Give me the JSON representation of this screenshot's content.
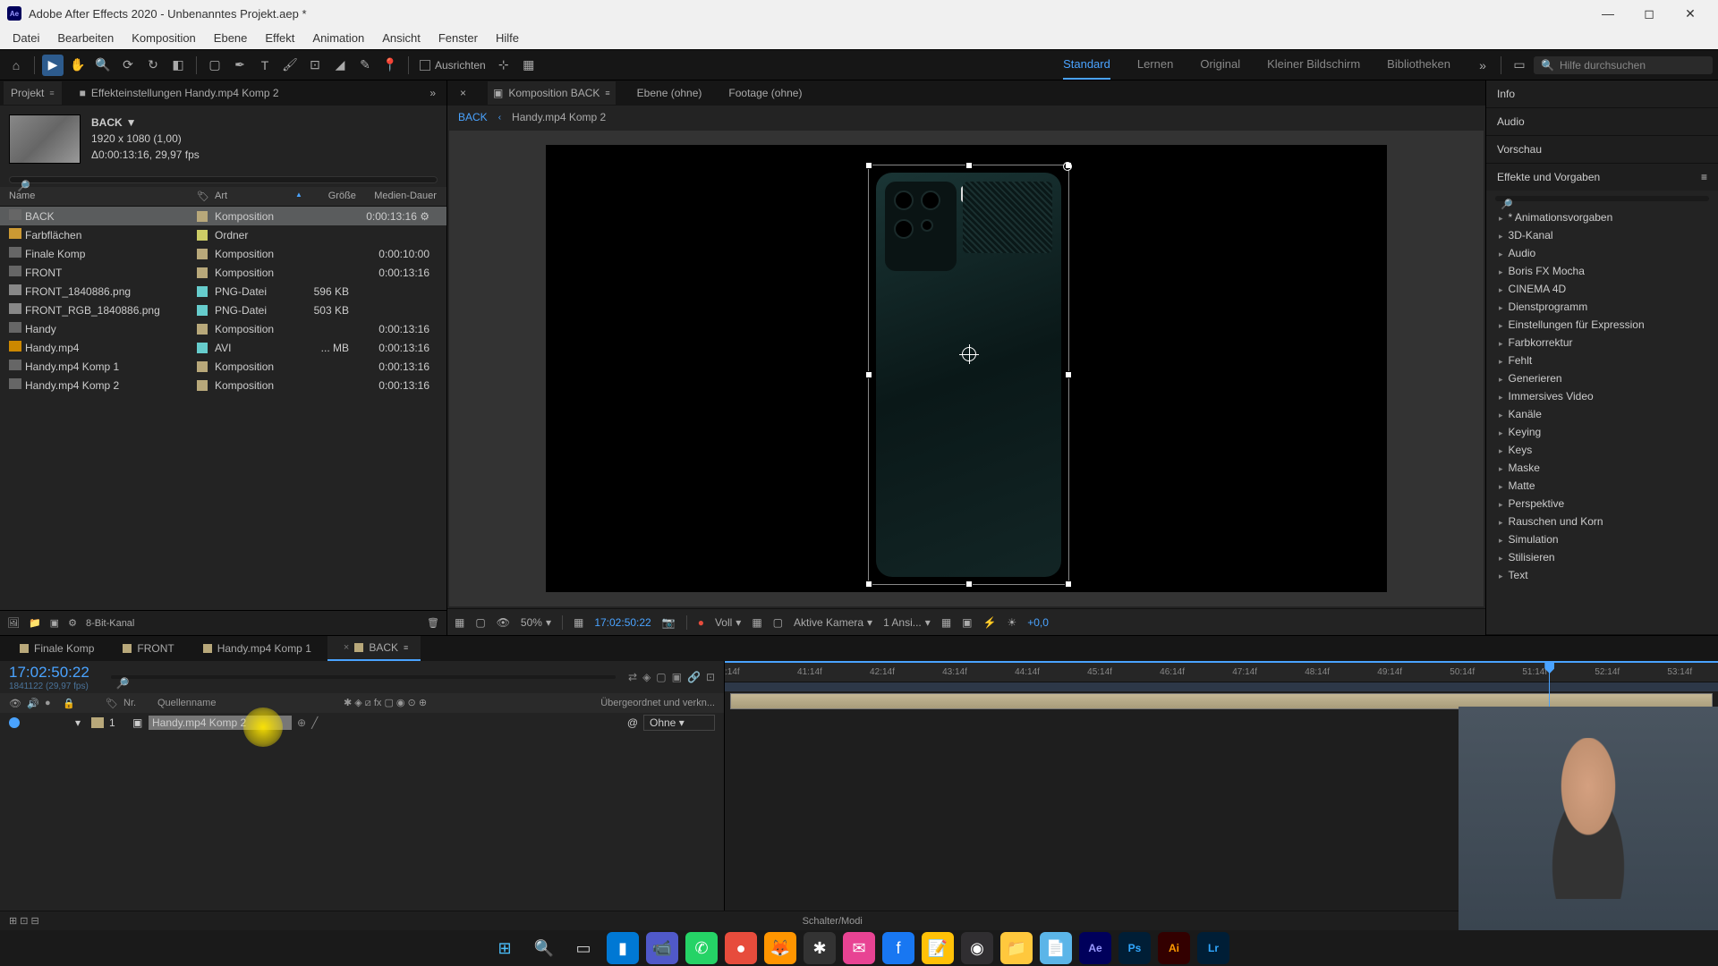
{
  "titlebar": {
    "app_icon": "Ae",
    "title": "Adobe After Effects 2020 - Unbenanntes Projekt.aep *"
  },
  "menubar": [
    "Datei",
    "Bearbeiten",
    "Komposition",
    "Ebene",
    "Effekt",
    "Animation",
    "Ansicht",
    "Fenster",
    "Hilfe"
  ],
  "toolbar": {
    "align_label": "Ausrichten",
    "workspaces": [
      "Standard",
      "Lernen",
      "Original",
      "Kleiner Bildschirm",
      "Bibliotheken"
    ],
    "search_placeholder": "Hilfe durchsuchen"
  },
  "project_panel": {
    "tabs": {
      "project": "Projekt",
      "effects": "Effekteinstellungen Handy.mp4 Komp 2"
    },
    "selected_name": "BACK",
    "dimensions": "1920 x 1080 (1,00)",
    "duration_info": "Δ0:00:13:16, 29,97 fps",
    "columns": {
      "name": "Name",
      "art": "Art",
      "size": "Größe",
      "duration": "Medien-Dauer"
    },
    "items": [
      {
        "name": "BACK",
        "icon": "comp",
        "art": "Komposition",
        "size": "",
        "dur": "0:00:13:16",
        "label": "#b8a87a",
        "selected": true
      },
      {
        "name": "Farbflächen",
        "icon": "folder",
        "art": "Ordner",
        "size": "",
        "dur": "",
        "label": "#cccc66"
      },
      {
        "name": "Finale Komp",
        "icon": "comp",
        "art": "Komposition",
        "size": "",
        "dur": "0:00:10:00",
        "label": "#b8a87a"
      },
      {
        "name": "FRONT",
        "icon": "comp",
        "art": "Komposition",
        "size": "",
        "dur": "0:00:13:16",
        "label": "#b8a87a"
      },
      {
        "name": "FRONT_1840886.png",
        "icon": "file",
        "art": "PNG-Datei",
        "size": "596 KB",
        "dur": "",
        "label": "#66cccc"
      },
      {
        "name": "FRONT_RGB_1840886.png",
        "icon": "file",
        "art": "PNG-Datei",
        "size": "503 KB",
        "dur": "",
        "label": "#66cccc"
      },
      {
        "name": "Handy",
        "icon": "comp",
        "art": "Komposition",
        "size": "",
        "dur": "0:00:13:16",
        "label": "#b8a87a"
      },
      {
        "name": "Handy.mp4",
        "icon": "video",
        "art": "AVI",
        "size": "... MB",
        "dur": "0:00:13:16",
        "label": "#66cccc"
      },
      {
        "name": "Handy.mp4 Komp 1",
        "icon": "comp",
        "art": "Komposition",
        "size": "",
        "dur": "0:00:13:16",
        "label": "#b8a87a"
      },
      {
        "name": "Handy.mp4 Komp 2",
        "icon": "comp",
        "art": "Komposition",
        "size": "",
        "dur": "0:00:13:16",
        "label": "#b8a87a"
      }
    ],
    "footer_bits": "8-Bit-Kanal"
  },
  "comp_panel": {
    "tabs": {
      "comp": "Komposition BACK",
      "layer": "Ebene (ohne)",
      "footage": "Footage (ohne)"
    },
    "breadcrumb": [
      "BACK",
      "Handy.mp4 Komp 2"
    ],
    "footer": {
      "zoom": "50%",
      "timecode": "17:02:50:22",
      "resolution": "Voll",
      "camera": "Aktive Kamera",
      "views": "1 Ansi...",
      "exposure": "+0,0"
    }
  },
  "right_panels": {
    "info": "Info",
    "audio": "Audio",
    "preview": "Vorschau",
    "effects_title": "Effekte und Vorgaben",
    "tree": [
      "* Animationsvorgaben",
      "3D-Kanal",
      "Audio",
      "Boris FX Mocha",
      "CINEMA 4D",
      "Dienstprogramm",
      "Einstellungen für Expression",
      "Farbkorrektur",
      "Fehlt",
      "Generieren",
      "Immersives Video",
      "Kanäle",
      "Keying",
      "Keys",
      "Maske",
      "Matte",
      "Perspektive",
      "Rauschen und Korn",
      "Simulation",
      "Stilisieren",
      "Text"
    ]
  },
  "timeline": {
    "tabs": [
      "Finale Komp",
      "FRONT",
      "Handy.mp4 Komp 1",
      "BACK"
    ],
    "active_tab": 3,
    "current_time": "17:02:50:22",
    "current_frame": "1841122 (29,97 fps)",
    "columns": {
      "nr": "Nr.",
      "source": "Quellenname",
      "parent": "Übergeordnet und verkn..."
    },
    "layer": {
      "num": "1",
      "name": "Handy.mp4 Komp 2",
      "parent": "Ohne"
    },
    "ruler_ticks": [
      ":14f",
      "41:14f",
      "42:14f",
      "43:14f",
      "44:14f",
      "45:14f",
      "46:14f",
      "47:14f",
      "48:14f",
      "49:14f",
      "50:14f",
      "51:14f",
      "52:14f",
      "53:14f"
    ],
    "footer_label": "Schalter/Modi"
  },
  "taskbar": {
    "apps": [
      {
        "name": "windows",
        "bg": "transparent",
        "glyph": "⊞",
        "color": "#4cc2ff"
      },
      {
        "name": "search",
        "bg": "transparent",
        "glyph": "🔍",
        "color": "#fff"
      },
      {
        "name": "taskview",
        "bg": "transparent",
        "glyph": "▭",
        "color": "#ccc"
      },
      {
        "name": "app1",
        "bg": "#0078d4",
        "glyph": "▮",
        "color": "#fff"
      },
      {
        "name": "teams",
        "bg": "#5059c9",
        "glyph": "📹",
        "color": "#fff"
      },
      {
        "name": "whatsapp",
        "bg": "#25d366",
        "glyph": "✆",
        "color": "#fff"
      },
      {
        "name": "app2",
        "bg": "#e74c3c",
        "glyph": "●",
        "color": "#fff"
      },
      {
        "name": "firefox",
        "bg": "#ff9500",
        "glyph": "🦊",
        "color": "#fff"
      },
      {
        "name": "app3",
        "bg": "#333",
        "glyph": "✱",
        "color": "#fff"
      },
      {
        "name": "messenger",
        "bg": "#e84393",
        "glyph": "✉",
        "color": "#fff"
      },
      {
        "name": "facebook",
        "bg": "#1877f2",
        "glyph": "f",
        "color": "#fff"
      },
      {
        "name": "notes",
        "bg": "#ffc107",
        "glyph": "📝",
        "color": "#333"
      },
      {
        "name": "obs",
        "bg": "#302e31",
        "glyph": "◉",
        "color": "#fff"
      },
      {
        "name": "explorer",
        "bg": "#ffc83d",
        "glyph": "📁",
        "color": "#333"
      },
      {
        "name": "notepad",
        "bg": "#5bb5e8",
        "glyph": "📄",
        "color": "#fff"
      },
      {
        "name": "ae",
        "bg": "#00005b",
        "glyph": "Ae",
        "color": "#9999ff"
      },
      {
        "name": "ps",
        "bg": "#001e36",
        "glyph": "Ps",
        "color": "#31a8ff"
      },
      {
        "name": "ai",
        "bg": "#330000",
        "glyph": "Ai",
        "color": "#ff9a00"
      },
      {
        "name": "lr",
        "bg": "#001e36",
        "glyph": "Lr",
        "color": "#31a8ff"
      }
    ]
  }
}
